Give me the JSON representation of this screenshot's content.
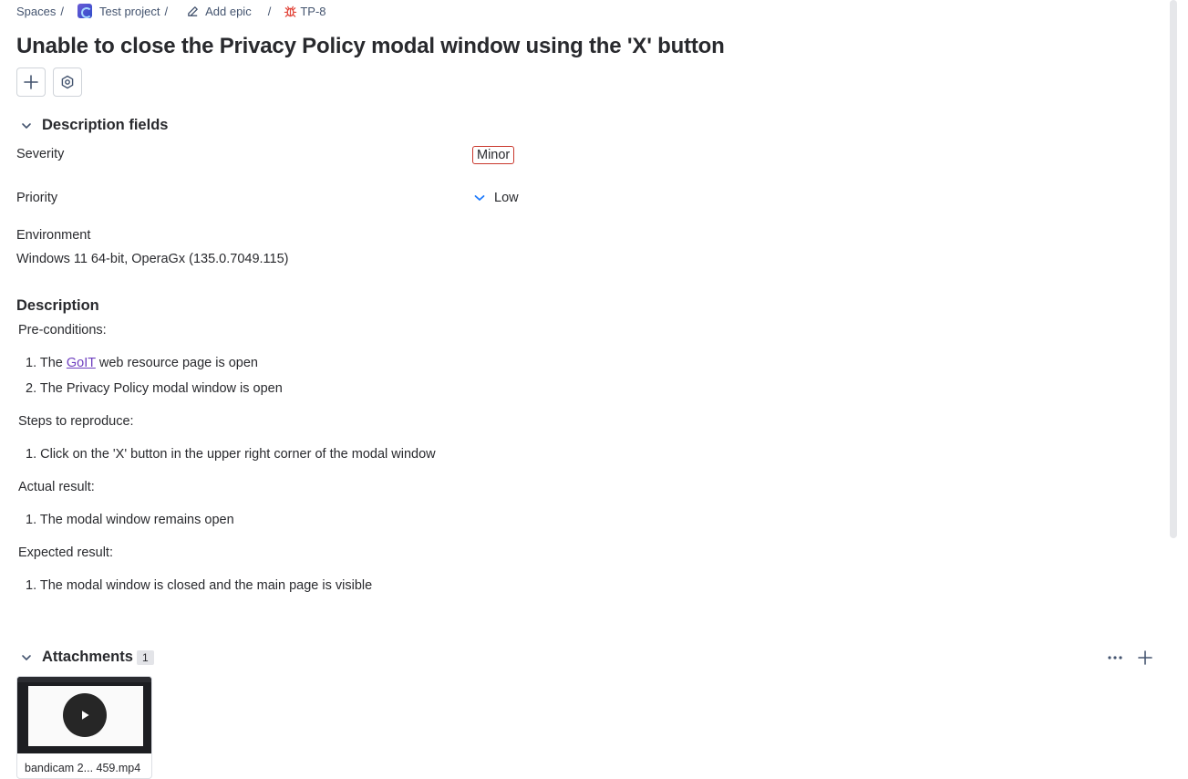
{
  "breadcrumb": {
    "spaces": "Spaces",
    "project": "Test project",
    "epic": "Add epic",
    "issue_key": "TP-8",
    "separator": "/"
  },
  "issue": {
    "title": "Unable to close the Privacy Policy modal window using the 'X' button"
  },
  "description_fields": {
    "heading": "Description fields",
    "severity_label": "Severity",
    "severity_value": "Minor",
    "priority_label": "Priority",
    "priority_value": "Low",
    "environment_label": "Environment",
    "environment_value": "Windows 11 64-bit, OperaGx (135.0.7049.115)"
  },
  "description": {
    "heading": "Description",
    "preconditions_label": "Pre-conditions:",
    "pre_1_prefix": "1. The ",
    "pre_1_link": "GoIT",
    "pre_1_suffix": " web resource page is open",
    "pre_2": "2. The Privacy Policy modal window is open",
    "steps_label": "Steps to reproduce:",
    "step_1": "1. Click on the 'X' button in the upper right corner of the modal window",
    "actual_label": "Actual result:",
    "actual_1": "1. The modal window remains open",
    "expected_label": "Expected result:",
    "expected_1": "1. The modal window is closed and the main page is visible"
  },
  "attachments": {
    "heading": "Attachments",
    "count": "1",
    "file_name": "bandicam 2... 459.mp4"
  },
  "colors": {
    "severity_border": "#c9372c",
    "priority_icon": "#1d7afc",
    "link": "#6e3fbf",
    "bug_icon": "#e2483d"
  },
  "icons": {
    "add": "plus-icon",
    "settings": "settings-icon",
    "more": "more-icon",
    "bug": "bug-icon",
    "edit": "edit-icon"
  }
}
